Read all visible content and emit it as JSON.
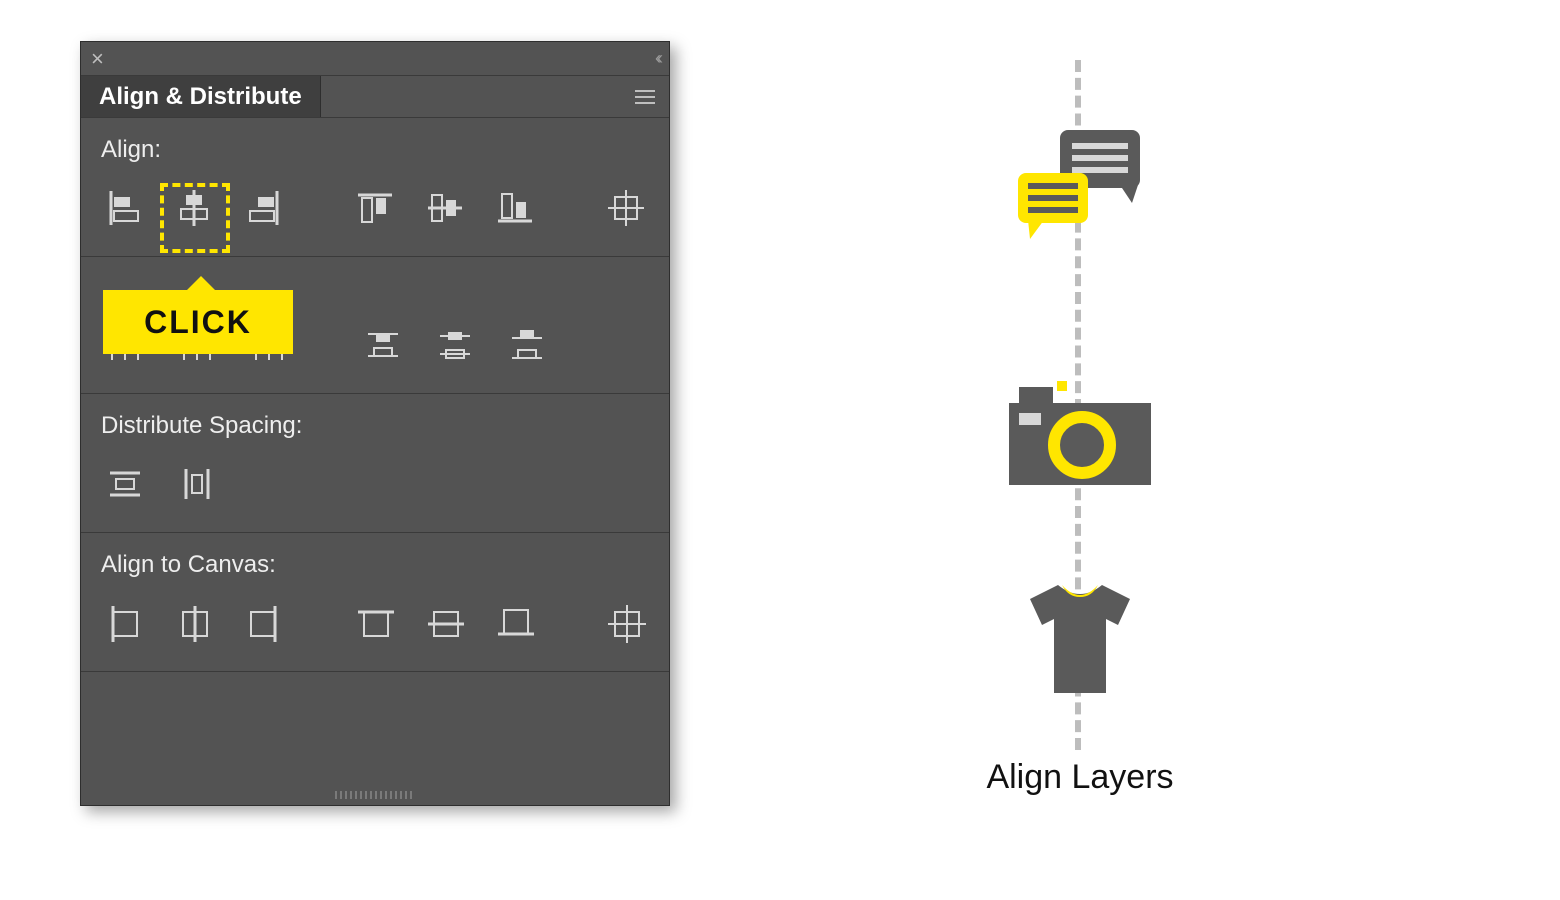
{
  "panel": {
    "tab_title": "Align & Distribute",
    "sections": {
      "align_label": "Align:",
      "distribute_spacing_label": "Distribute Spacing:",
      "align_canvas_label": "Align to Canvas:"
    }
  },
  "click_tag": "CLICK",
  "right_caption": "Align Layers",
  "colors": {
    "accent": "#ffe600",
    "panel": "#535353",
    "icon_grey": "#5a5a5a"
  }
}
